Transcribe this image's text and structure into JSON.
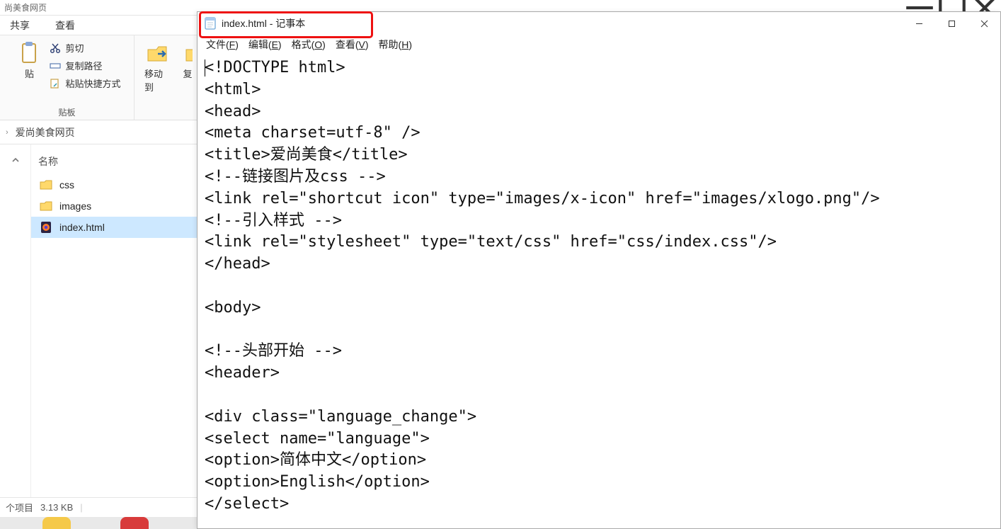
{
  "explorer": {
    "title_fragment": "尚美食网页",
    "tabs": {
      "share": "共享",
      "view": "查看"
    },
    "ribbon": {
      "paste_label": "贴",
      "cut": "剪切",
      "copy_path": "复制路径",
      "paste_shortcut": "粘贴快捷方式",
      "clipboard_group": "贴板",
      "move_to": "移动到",
      "copy_fragment": "复"
    },
    "path": {
      "arrow": "›",
      "folder": "爱尚美食网页"
    },
    "list": {
      "header_name": "名称",
      "items": [
        {
          "name": "css",
          "type": "folder"
        },
        {
          "name": "images",
          "type": "folder"
        },
        {
          "name": "index.html",
          "type": "file"
        }
      ]
    },
    "status": {
      "items": "个项目",
      "size": "3.13 KB"
    }
  },
  "notepad": {
    "title": "index.html - 记事本",
    "menu": {
      "file": "文件(F)",
      "edit": "编辑(E)",
      "format": "格式(O)",
      "view": "查看(V)",
      "help": "帮助(H)"
    },
    "content_lines": [
      "<!DOCTYPE html>",
      "<html>",
      "<head>",
      "<meta charset=utf-8\" />",
      "<title>爱尚美食</title>",
      "<!--链接图片及css -->",
      "<link rel=\"shortcut icon\" type=\"images/x-icon\" href=\"images/xlogo.png\"/>",
      "<!--引入样式 -->",
      "<link rel=\"stylesheet\" type=\"text/css\" href=\"css/index.css\"/>",
      "</head>",
      "",
      "<body>",
      "",
      "<!--头部开始 -->",
      "<header>",
      "",
      "<div class=\"language_change\">",
      "<select name=\"language\">",
      "<option>简体中文</option>",
      "<option>English</option>",
      "</select>"
    ]
  }
}
